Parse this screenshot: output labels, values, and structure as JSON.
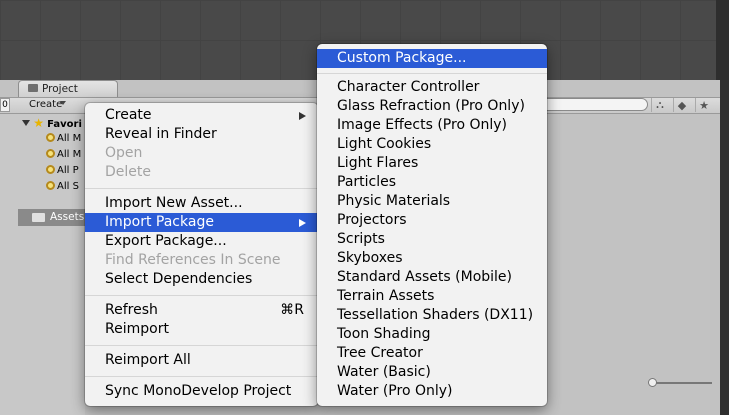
{
  "panel": {
    "tab_label": "Project",
    "create_label": "Create",
    "left_stub": "0"
  },
  "tree": {
    "favorites_label": "Favori",
    "items": [
      "All M",
      "All M",
      "All P",
      "All S"
    ],
    "assets_label": "Assets"
  },
  "context_menu": {
    "items": [
      {
        "label": "Create"
      },
      {
        "label": "Reveal in Finder"
      },
      {
        "label": "Open"
      },
      {
        "label": "Delete"
      },
      {
        "label": "Import New Asset..."
      },
      {
        "label": "Import Package"
      },
      {
        "label": "Export Package..."
      },
      {
        "label": "Find References In Scene"
      },
      {
        "label": "Select Dependencies"
      },
      {
        "label": "Refresh",
        "shortcut": "⌘R"
      },
      {
        "label": "Reimport"
      },
      {
        "label": "Reimport All"
      },
      {
        "label": "Sync MonoDevelop Project"
      }
    ]
  },
  "package_menu": {
    "items": [
      "Custom Package...",
      "Character Controller",
      "Glass Refraction (Pro Only)",
      "Image Effects (Pro Only)",
      "Light Cookies",
      "Light Flares",
      "Particles",
      "Physic Materials",
      "Projectors",
      "Scripts",
      "Skyboxes",
      "Standard Assets (Mobile)",
      "Terrain Assets",
      "Tessellation Shaders (DX11)",
      "Toon Shading",
      "Tree Creator",
      "Water (Basic)",
      "Water (Pro Only)"
    ]
  },
  "colors": {
    "highlight": "#2b5bd6",
    "disabled_text": "#a3a3a3"
  }
}
